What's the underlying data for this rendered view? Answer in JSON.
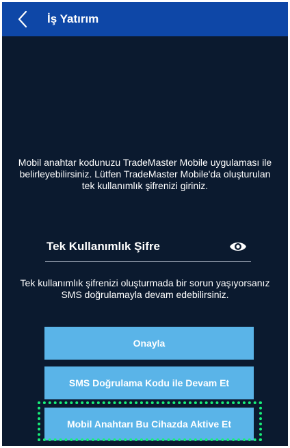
{
  "app_bar": {
    "title": "İş Yatırım",
    "back_icon": "chevron-left-icon",
    "background_color": "#0e47a7"
  },
  "main": {
    "info_text": "Mobil anahtar kodunuzu TradeMaster Mobile uygulaması ile belirleyebilirsiniz. Lütfen TradeMaster Mobile'da oluşturulan tek kullanımlık şifrenizi giriniz.",
    "password_field": {
      "placeholder": "Tek Kullanımlık Şifre",
      "value": "",
      "toggle_icon": "eye-icon"
    },
    "help_text": "Tek kullanımlık şifrenizi oluşturmada bir sorun yaşıyorsanız SMS doğrulamayla devam edebilirsiniz.",
    "buttons": {
      "confirm_label": "Onayla",
      "sms_label": "SMS Doğrulama Kodu ile Devam Et",
      "activate_label": "Mobil Anahtarı Bu Cihazda Aktive Et"
    }
  },
  "colors": {
    "background": "#0b1a2f",
    "button": "#5ab4e8",
    "highlight": "#18f07a"
  }
}
